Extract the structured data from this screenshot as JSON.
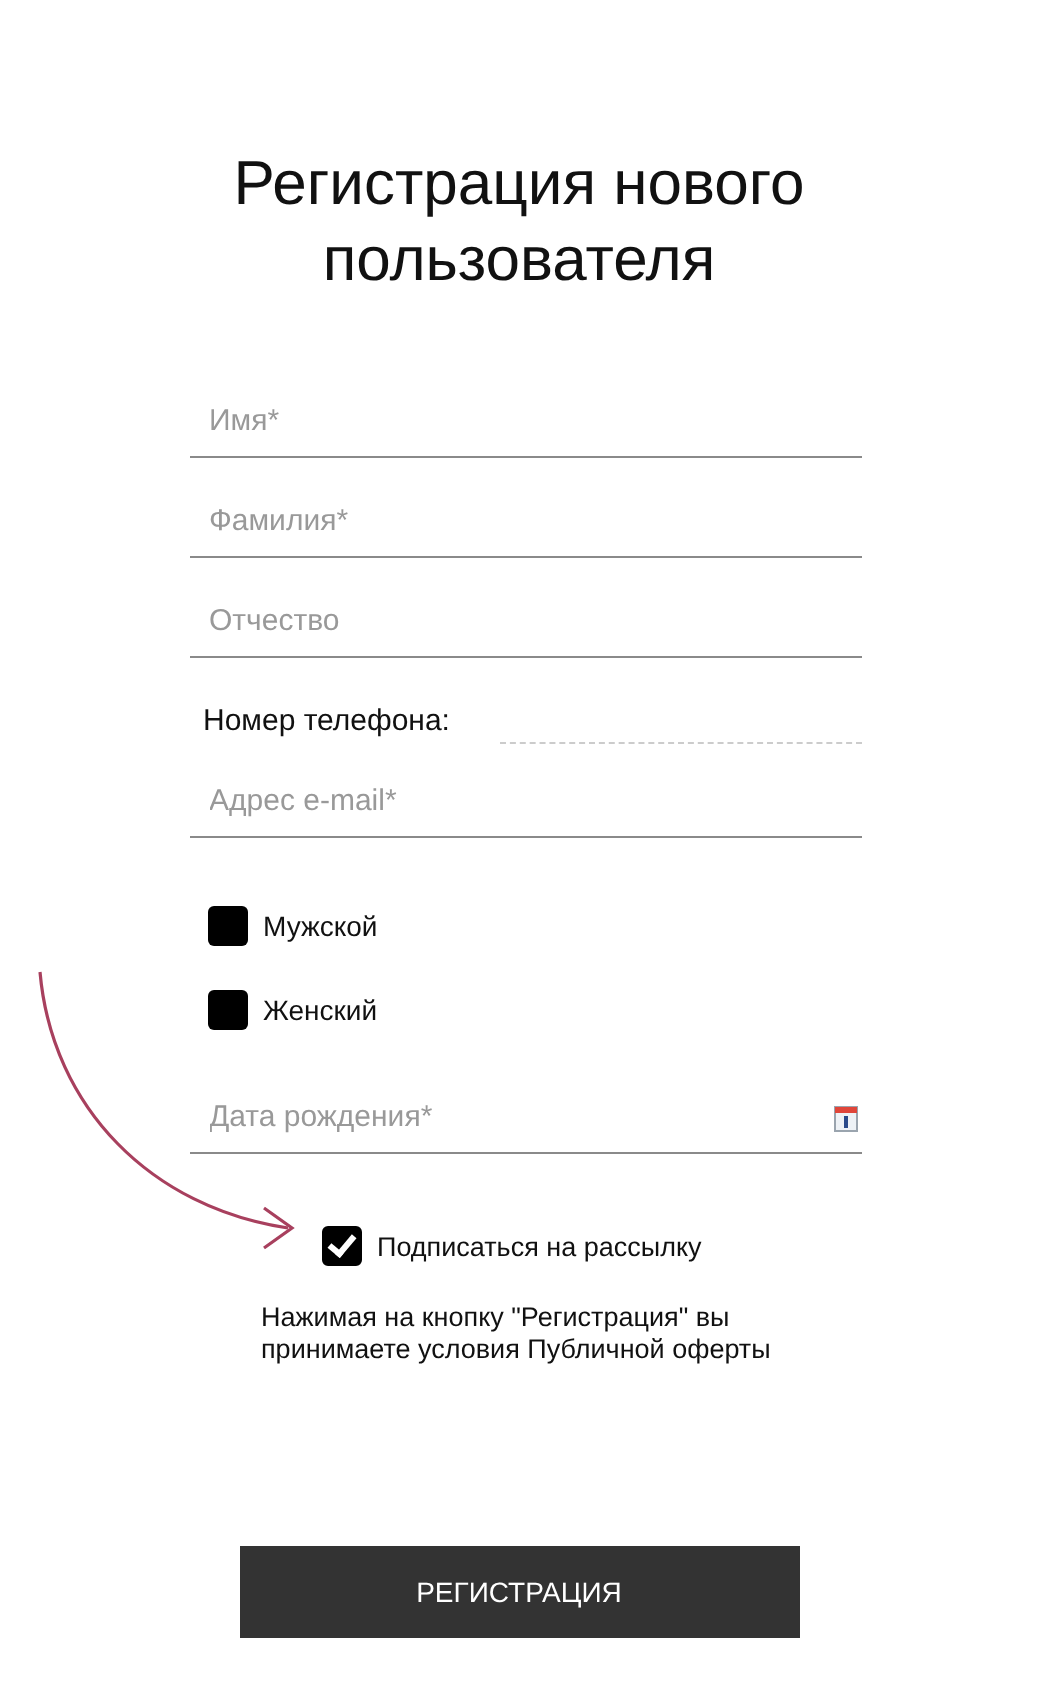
{
  "title": "Регистрация нового пользователя",
  "fields": [
    {
      "kind": "text",
      "placeholder": "Имя*"
    },
    {
      "kind": "text",
      "placeholder": "Фамилия*"
    },
    {
      "kind": "text",
      "placeholder": "Отчество"
    },
    {
      "kind": "phone",
      "label": "Номер телефона:"
    },
    {
      "kind": "text",
      "placeholder": "Адрес e-mail*"
    }
  ],
  "gender": [
    {
      "label": "Мужской",
      "selected": false
    },
    {
      "label": "Женский",
      "selected": false
    }
  ],
  "birth_date": {
    "placeholder": "Дата рождения*"
  },
  "subscribe": {
    "label": "Подписаться на рассылку",
    "checked": true
  },
  "notice": "Нажимая на кнопку \"Регистрация\" вы принимаете условия Публичной оферты",
  "submit": "РЕГИСТРАЦИЯ"
}
